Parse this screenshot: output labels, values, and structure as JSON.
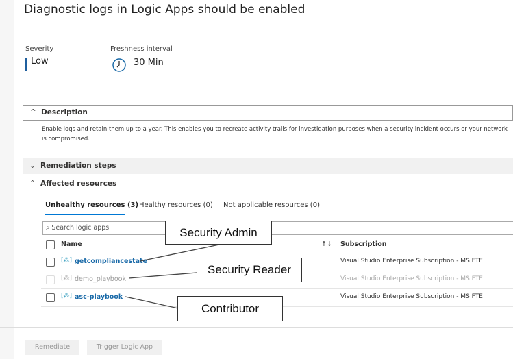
{
  "title": "Diagnostic logs in Logic Apps should be enabled",
  "severity": {
    "label": "Severity",
    "value": "Low"
  },
  "freshness": {
    "label": "Freshness interval",
    "value": "30 Min"
  },
  "sections": {
    "description": "Description",
    "remediation": "Remediation steps",
    "affected": "Affected resources"
  },
  "description_text": "Enable logs and retain them up to a year. This enables you to recreate activity trails for investigation purposes when a security incident occurs or your network is compromised.",
  "tabs": [
    "Unhealthy resources (3)",
    "Healthy resources (0)",
    "Not applicable resources (0)"
  ],
  "search_placeholder": "Search logic apps",
  "columns": {
    "name": "Name",
    "sort": "↑↓",
    "subscription": "Subscription"
  },
  "rows": [
    {
      "name": "getcompliancestate",
      "subscription": "Visual Studio Enterprise Subscription - MS FTE"
    },
    {
      "name": "demo_playbook",
      "subscription": "Visual Studio Enterprise Subscription - MS FTE"
    },
    {
      "name": "asc-playbook",
      "subscription": "Visual Studio Enterprise Subscription - MS FTE"
    }
  ],
  "buttons": {
    "remediate": "Remediate",
    "trigger": "Trigger Logic App"
  },
  "callouts": [
    "Security Admin",
    "Security Reader",
    "Contributor"
  ]
}
